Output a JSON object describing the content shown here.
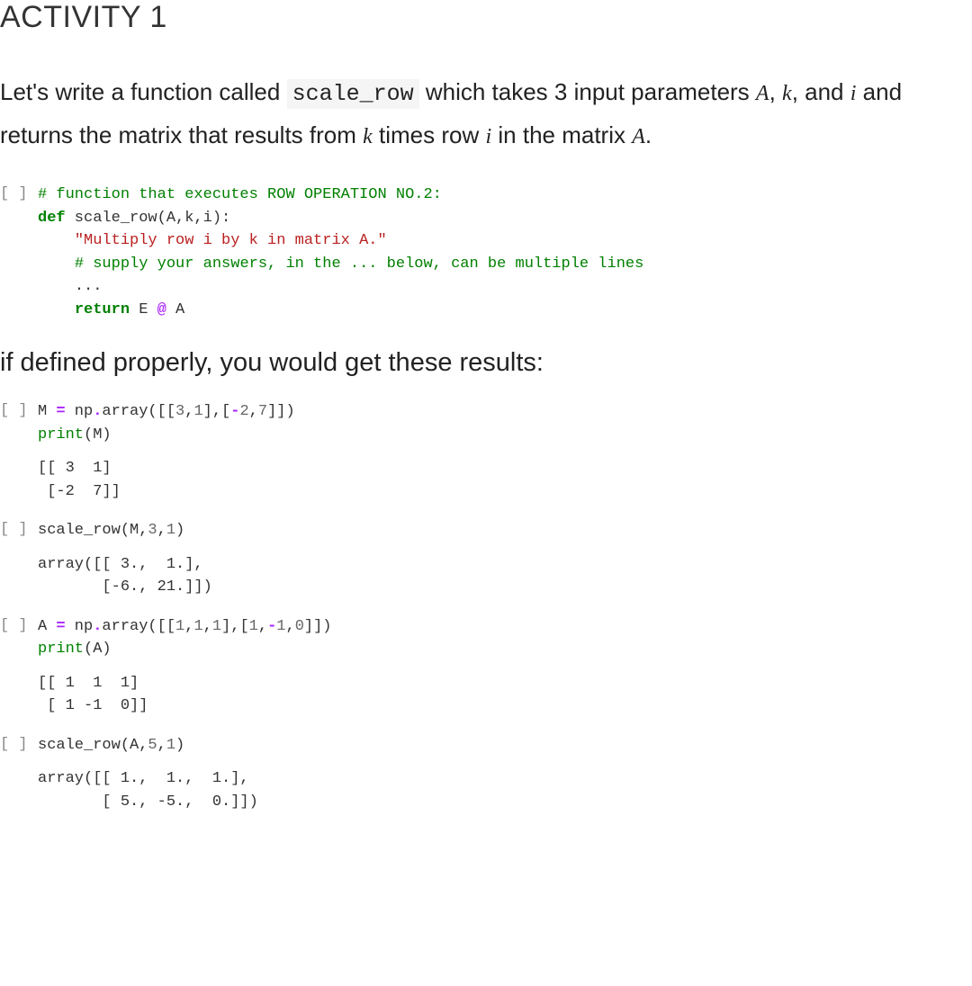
{
  "heading": "ACTIVITY 1",
  "description": {
    "part1": "Let's write a function called ",
    "code": "scale_row",
    "part2": " which takes 3 input parameters ",
    "var_A": "A",
    "comma1": ", ",
    "var_k": "k",
    "comma2": ", and ",
    "var_i": "i",
    "part3": " and returns the matrix that results from ",
    "var_k2": "k",
    "part4": " times row ",
    "var_i2": "i",
    "part5": " in the matrix ",
    "var_A2": "A",
    "period": "."
  },
  "subheading": "if defined properly, you would get these results:",
  "prompt": "[ ]",
  "cells": {
    "c1": {
      "l1_comment": "# function that executes ROW OPERATION NO.2:",
      "l2_def": "def",
      "l2_sig": " scale_row(A,k,i):",
      "l3_doc": "\"Multiply row i by k in matrix A.\"",
      "l4_comment": "# supply your answers, in the ... below, can be multiple lines",
      "l5_ellipsis": "...",
      "l6_return": "return",
      "l6_expr": " E ",
      "l6_op": "@",
      "l6_expr2": " A"
    },
    "c2": {
      "code_l1_a": "M ",
      "code_l1_eq": "=",
      "code_l1_b": " np",
      "code_l1_dot": ".",
      "code_l1_c": "array([[",
      "code_l1_n1": "3",
      "code_l1_cm1": ",",
      "code_l1_n2": "1",
      "code_l1_cm2": "],[",
      "code_l1_n3": "-",
      "code_l1_n3b": "2",
      "code_l1_cm3": ",",
      "code_l1_n4": "7",
      "code_l1_end": "]])",
      "code_l2_print": "print",
      "code_l2_arg": "(M)",
      "output": "[[ 3  1]\n [-2  7]]"
    },
    "c3": {
      "code_a": "scale_row(M,",
      "code_n1": "3",
      "code_cm": ",",
      "code_n2": "1",
      "code_end": ")",
      "output": "array([[ 3.,  1.],\n       [-6., 21.]])"
    },
    "c4": {
      "code_l1_a": "A ",
      "code_l1_eq": "=",
      "code_l1_b": " np",
      "code_l1_dot": ".",
      "code_l1_c": "array([[",
      "code_l1_n1": "1",
      "code_l1_cm1": ",",
      "code_l1_n2": "1",
      "code_l1_cm2": ",",
      "code_l1_n3": "1",
      "code_l1_cm3": "],[",
      "code_l1_n4": "1",
      "code_l1_cm4": ",",
      "code_l1_n5": "-",
      "code_l1_n5b": "1",
      "code_l1_cm5": ",",
      "code_l1_n6": "0",
      "code_l1_end": "]])",
      "code_l2_print": "print",
      "code_l2_arg": "(A)",
      "output": "[[ 1  1  1]\n [ 1 -1  0]]"
    },
    "c5": {
      "code_a": "scale_row(A,",
      "code_n1": "5",
      "code_cm": ",",
      "code_n2": "1",
      "code_end": ")",
      "output": "array([[ 1.,  1.,  1.],\n       [ 5., -5.,  0.]])"
    }
  }
}
